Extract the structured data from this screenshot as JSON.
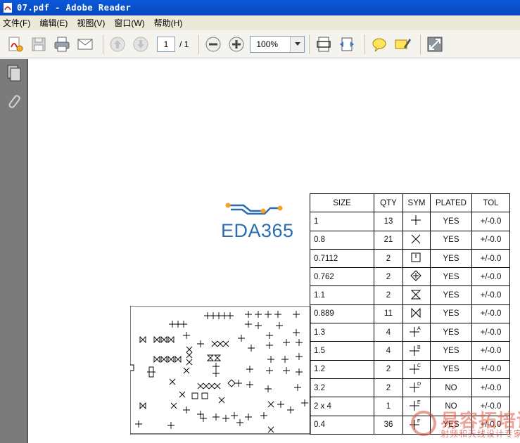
{
  "window": {
    "title": "07.pdf - Adobe Reader"
  },
  "menu": [
    "文件(F)",
    "编辑(E)",
    "视图(V)",
    "窗口(W)",
    "帮助(H)"
  ],
  "toolbar": {
    "page_current": "1",
    "page_total": "/ 1",
    "zoom": "100%"
  },
  "logo": {
    "text": "EDA365"
  },
  "table": {
    "headers": [
      "SIZE",
      "QTY",
      "SYM",
      "PLATED",
      "TOL"
    ],
    "rows": [
      {
        "size": "1",
        "qty": "13",
        "sym": "plus",
        "plated": "YES",
        "tol": "+/-0.0"
      },
      {
        "size": "0.8",
        "qty": "21",
        "sym": "x",
        "plated": "YES",
        "tol": "+/-0.0"
      },
      {
        "size": "0.7112",
        "qty": "2",
        "sym": "square-bar",
        "plated": "YES",
        "tol": "+/-0.0"
      },
      {
        "size": "0.762",
        "qty": "2",
        "sym": "diamond-plus",
        "plated": "YES",
        "tol": "+/-0.0"
      },
      {
        "size": "1.1",
        "qty": "2",
        "sym": "hourglass",
        "plated": "YES",
        "tol": "+/-0.0"
      },
      {
        "size": "0.889",
        "qty": "11",
        "sym": "bowtie",
        "plated": "YES",
        "tol": "+/-0.0"
      },
      {
        "size": "1.3",
        "qty": "4",
        "sym": "plus-A",
        "plated": "YES",
        "tol": "+/-0.0"
      },
      {
        "size": "1.5",
        "qty": "4",
        "sym": "plus-B",
        "plated": "YES",
        "tol": "+/-0.0"
      },
      {
        "size": "1.2",
        "qty": "2",
        "sym": "plus-C",
        "plated": "YES",
        "tol": "+/-0.0"
      },
      {
        "size": "3.2",
        "qty": "2",
        "sym": "plus-D",
        "plated": "NO",
        "tol": "+/-0.0"
      },
      {
        "size": "2 x 4",
        "qty": "1",
        "sym": "plus-E",
        "plated": "NO",
        "tol": "+/-0.0"
      },
      {
        "size": "0.4",
        "qty": "36",
        "sym": "plus-F",
        "plated": "YES",
        "tol": "+/-0.0"
      }
    ]
  },
  "watermark": {
    "text": "易容拓培训",
    "sub": "射频和天线设计专家"
  }
}
